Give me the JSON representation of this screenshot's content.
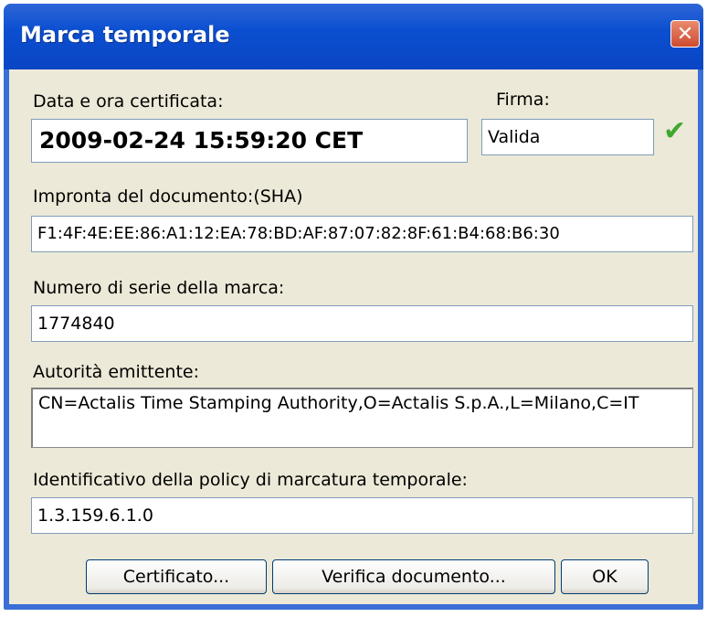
{
  "window": {
    "title": "Marca temporale"
  },
  "fields": {
    "date_label": "Data e ora certificata:",
    "date_value": "2009-02-24 15:59:20 CET",
    "signature_label": "Firma:",
    "signature_value": "Valida",
    "hash_label": "Impronta del documento:(SHA)",
    "hash_value": "F1:4F:4E:EE:86:A1:12:EA:78:BD:AF:87:07:82:8F:61:B4:68:B6:30",
    "serial_label": "Numero di serie della marca:",
    "serial_value": "1774840",
    "authority_label": "Autorità emittente:",
    "authority_value": "CN=Actalis Time Stamping Authority,O=Actalis S.p.A.,L=Milano,C=IT",
    "policy_label": "Identificativo della policy di marcatura temporale:",
    "policy_value": "1.3.159.6.1.0"
  },
  "buttons": {
    "certificate": "Certificato...",
    "verify": "Verifica documento...",
    "ok": "OK"
  },
  "icons": {
    "close": "close-icon",
    "check": "checkmark-icon"
  },
  "colors": {
    "titlebar": "#0a4fd0",
    "dialog_bg": "#ece9d8",
    "check": "#3fa82f"
  }
}
